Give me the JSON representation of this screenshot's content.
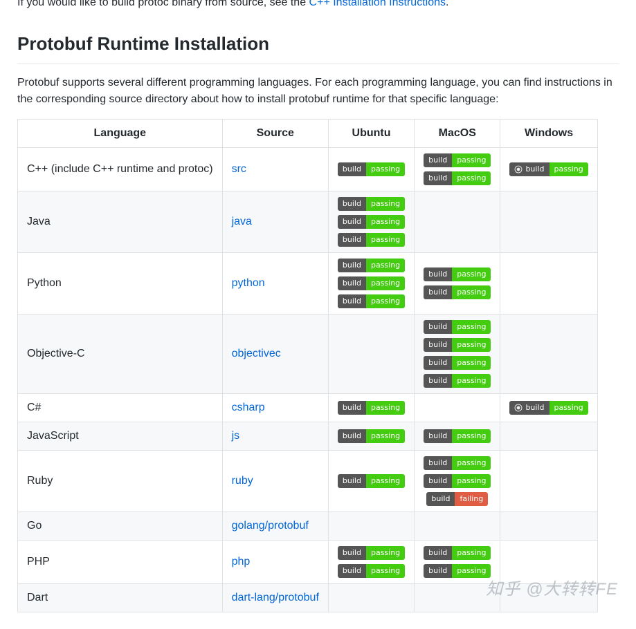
{
  "intro": {
    "prefix": "If you would like to build protoc binary from source, see the ",
    "link": "C++ Installation Instructions",
    "suffix": "."
  },
  "heading": "Protobuf Runtime Installation",
  "paragraph": "Protobuf supports several different programming languages. For each programming language, you can find instructions in the corresponding source directory about how to install protobuf runtime for that specific language:",
  "columns": [
    "Language",
    "Source",
    "Ubuntu",
    "MacOS",
    "Windows"
  ],
  "badge_labels": {
    "build": "build",
    "passing": "passing",
    "failing": "failing"
  },
  "rows": [
    {
      "language": "C++ (include C++ runtime and protoc)",
      "source": "src",
      "ubuntu": [
        {
          "status": "passing"
        }
      ],
      "macos": [
        {
          "status": "passing"
        },
        {
          "status": "passing"
        }
      ],
      "windows": [
        {
          "status": "passing",
          "appveyor": true
        }
      ]
    },
    {
      "language": "Java",
      "source": "java",
      "ubuntu": [
        {
          "status": "passing"
        },
        {
          "status": "passing"
        },
        {
          "status": "passing"
        }
      ],
      "macos": [],
      "windows": []
    },
    {
      "language": "Python",
      "source": "python",
      "ubuntu": [
        {
          "status": "passing"
        },
        {
          "status": "passing"
        },
        {
          "status": "passing"
        }
      ],
      "macos": [
        {
          "status": "passing"
        },
        {
          "status": "passing"
        }
      ],
      "windows": []
    },
    {
      "language": "Objective-C",
      "source": "objectivec",
      "ubuntu": [],
      "macos": [
        {
          "status": "passing"
        },
        {
          "status": "passing"
        },
        {
          "status": "passing"
        },
        {
          "status": "passing"
        }
      ],
      "windows": []
    },
    {
      "language": "C#",
      "source": "csharp",
      "ubuntu": [
        {
          "status": "passing"
        }
      ],
      "macos": [],
      "windows": [
        {
          "status": "passing",
          "appveyor": true
        }
      ]
    },
    {
      "language": "JavaScript",
      "source": "js",
      "ubuntu": [
        {
          "status": "passing"
        }
      ],
      "macos": [
        {
          "status": "passing"
        }
      ],
      "windows": []
    },
    {
      "language": "Ruby",
      "source": "ruby",
      "ubuntu": [
        {
          "status": "passing"
        }
      ],
      "macos": [
        {
          "status": "passing"
        },
        {
          "status": "passing"
        },
        {
          "status": "failing"
        }
      ],
      "windows": []
    },
    {
      "language": "Go",
      "source": "golang/protobuf",
      "ubuntu": [],
      "macos": [],
      "windows": []
    },
    {
      "language": "PHP",
      "source": "php",
      "ubuntu": [
        {
          "status": "passing"
        },
        {
          "status": "passing"
        }
      ],
      "macos": [
        {
          "status": "passing"
        },
        {
          "status": "passing"
        }
      ],
      "windows": []
    },
    {
      "language": "Dart",
      "source": "dart-lang/protobuf",
      "ubuntu": [],
      "macos": [],
      "windows": []
    }
  ],
  "watermark": "知乎 @大转转FE"
}
